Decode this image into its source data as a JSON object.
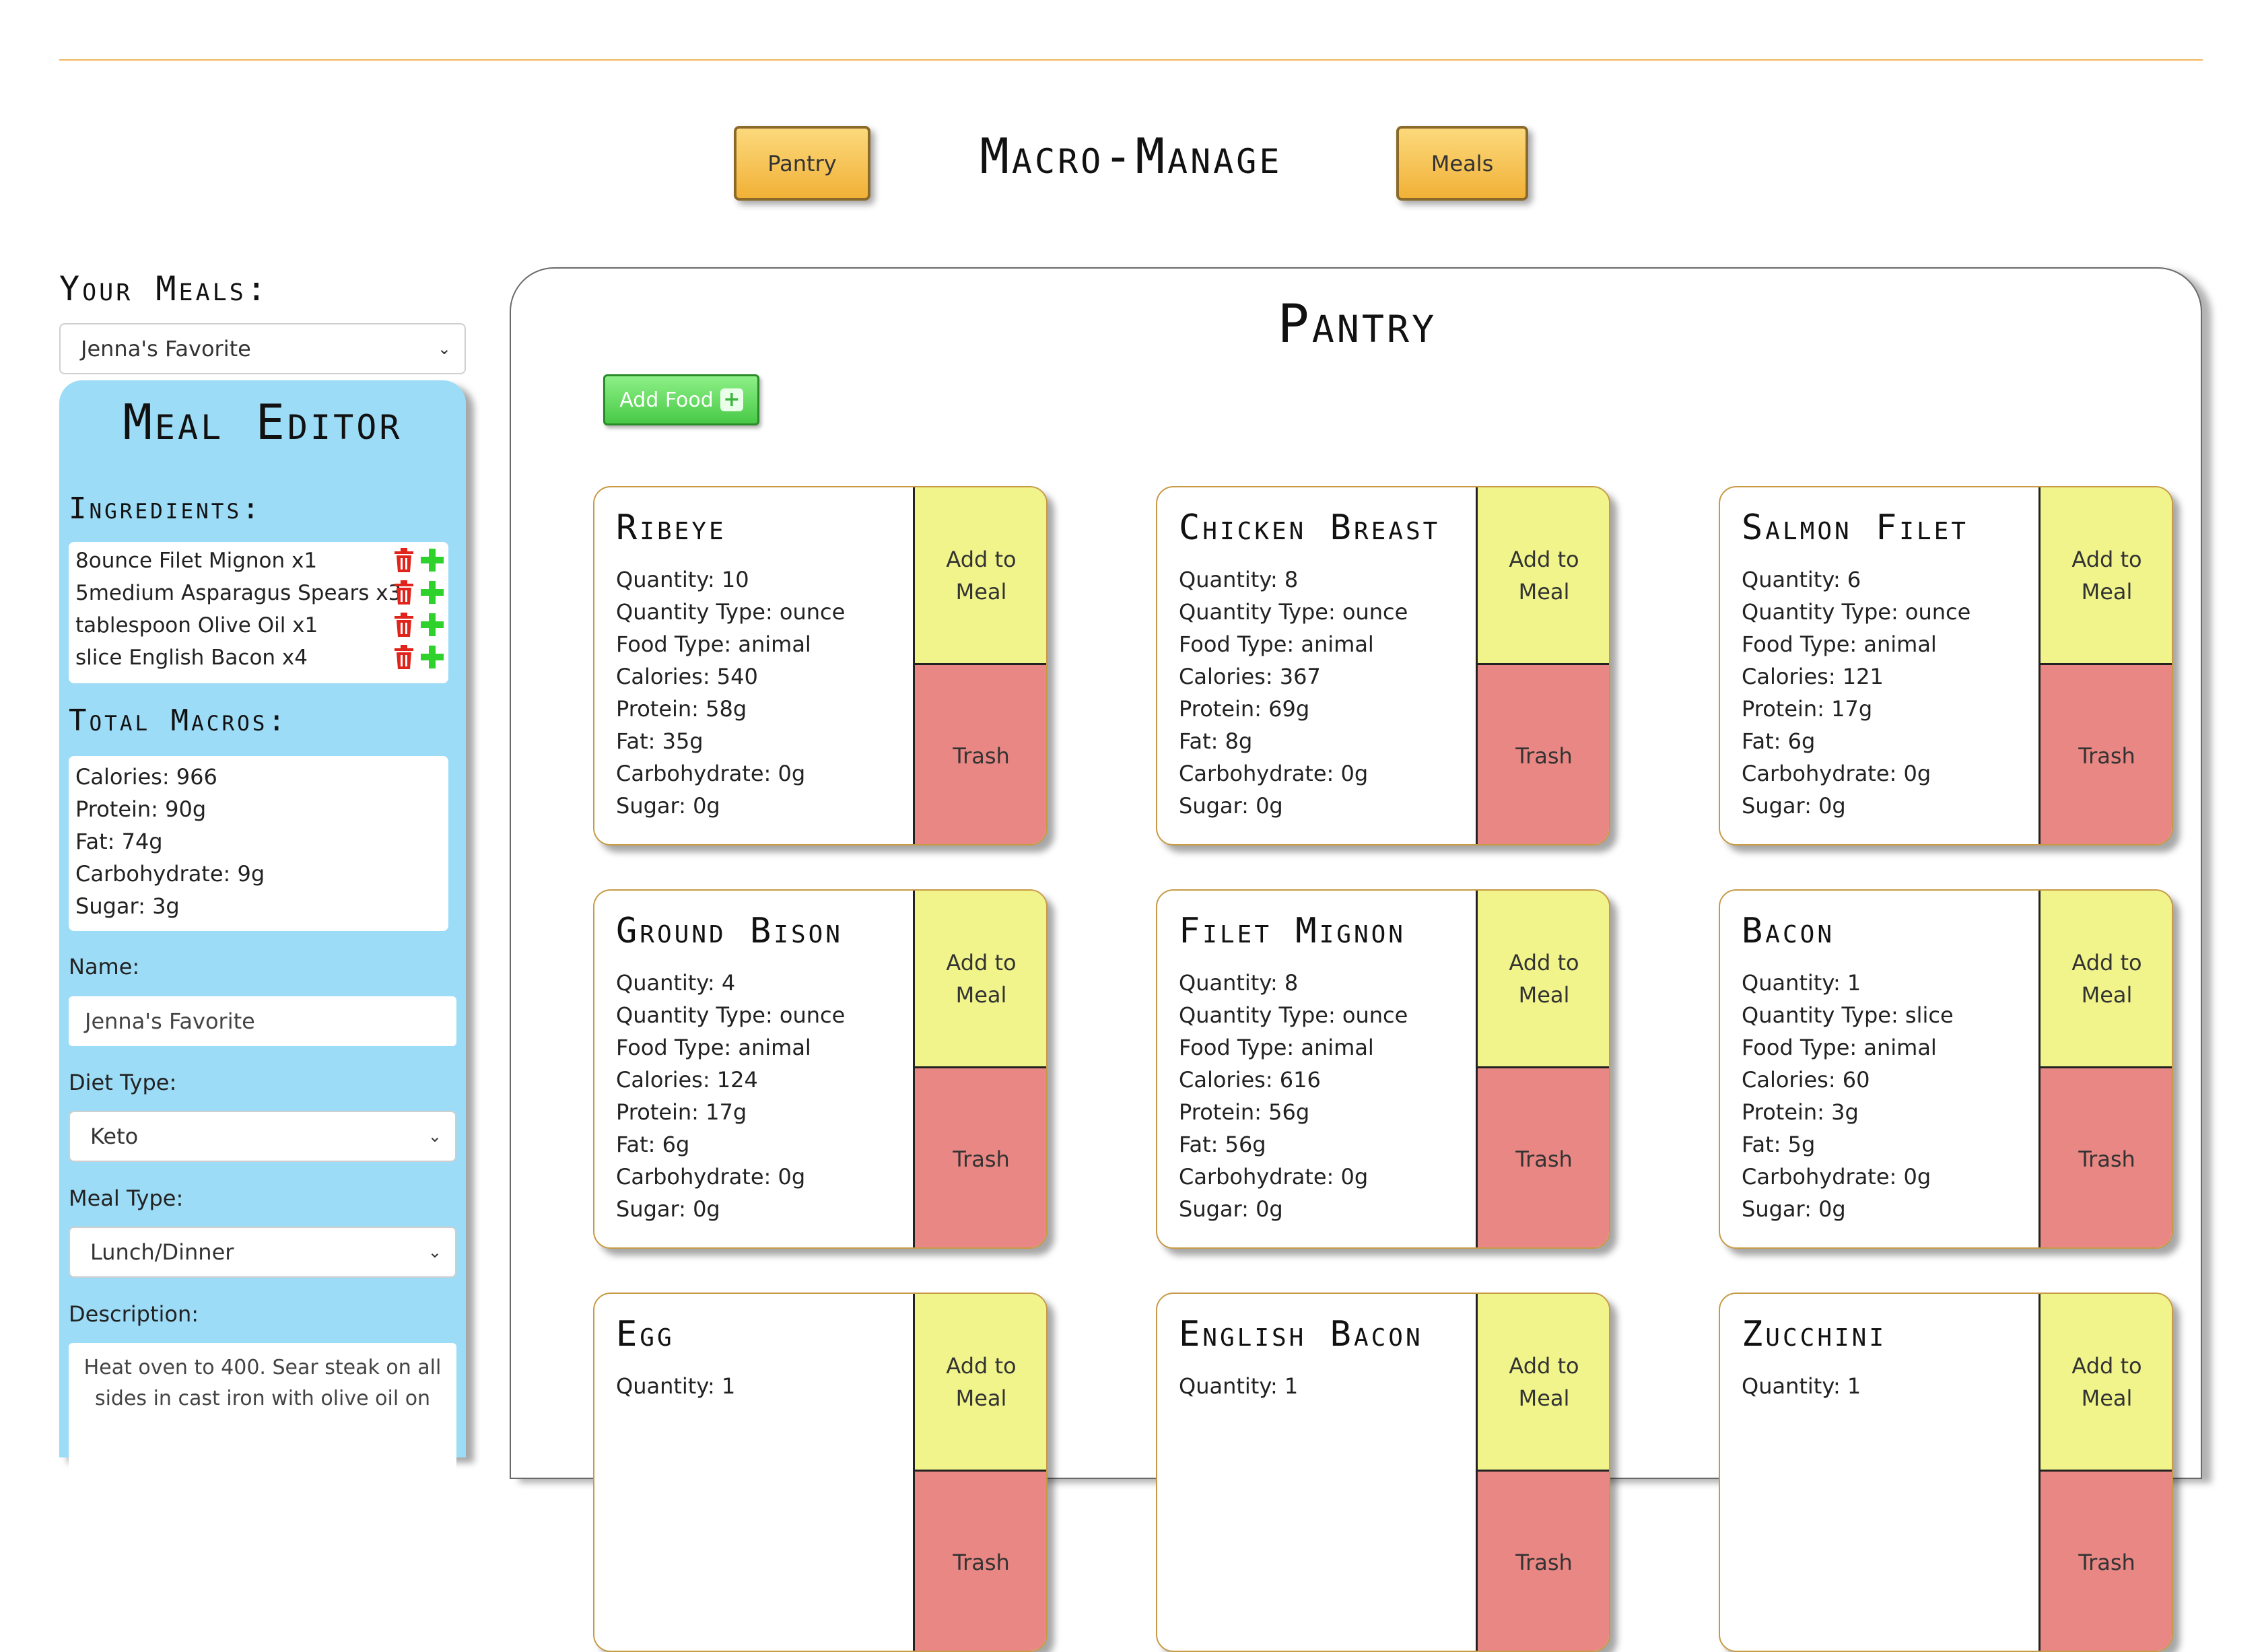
{
  "header": {
    "title": "Macro-Manage",
    "pantry_button": "Pantry",
    "meals_button": "Meals"
  },
  "sidebar": {
    "your_meals_label": "Your Meals:",
    "meal_select_value": "Jenna's Favorite",
    "editor_title": "Meal Editor",
    "ingredients_label": "Ingredients:",
    "ingredients": [
      "8ounce Filet Mignon x1",
      "5medium Asparagus Spears x3",
      "tablespoon Olive Oil x1",
      "slice English Bacon x4"
    ],
    "total_macros_label": "Total Macros:",
    "macros": [
      "Calories: 966",
      "Protein: 90g",
      "Fat: 74g",
      "Carbohydrate: 9g",
      "Sugar: 3g"
    ],
    "name_label": "Name:",
    "name_value": "Jenna's Favorite",
    "diet_label": "Diet Type:",
    "diet_value": "Keto",
    "meal_type_label": "Meal Type:",
    "meal_type_value": "Lunch/Dinner",
    "description_label": "Description:",
    "description_value": "Heat oven to 400. Sear steak on all sides in cast iron with olive oil on"
  },
  "pantry": {
    "title": "Pantry",
    "add_food_label": "Add Food",
    "add_to_meal_line1": "Add to",
    "add_to_meal_line2": "Meal",
    "trash_label": "Trash",
    "items": [
      {
        "name": "Ribeye",
        "lines": [
          "Quantity: 10",
          "Quantity Type: ounce",
          "Food Type: animal",
          "Calories: 540",
          "Protein: 58g",
          "Fat: 35g",
          "Carbohydrate: 0g",
          "Sugar: 0g"
        ]
      },
      {
        "name": "Chicken Breast",
        "lines": [
          "Quantity: 8",
          "Quantity Type: ounce",
          "Food Type: animal",
          "Calories: 367",
          "Protein: 69g",
          "Fat: 8g",
          "Carbohydrate: 0g",
          "Sugar: 0g"
        ]
      },
      {
        "name": "Salmon Filet",
        "lines": [
          "Quantity: 6",
          "Quantity Type: ounce",
          "Food Type: animal",
          "Calories: 121",
          "Protein: 17g",
          "Fat: 6g",
          "Carbohydrate: 0g",
          "Sugar: 0g"
        ]
      },
      {
        "name": "Ground Bison",
        "lines": [
          "Quantity: 4",
          "Quantity Type: ounce",
          "Food Type: animal",
          "Calories: 124",
          "Protein: 17g",
          "Fat: 6g",
          "Carbohydrate: 0g",
          "Sugar: 0g"
        ]
      },
      {
        "name": "Filet Mignon",
        "lines": [
          "Quantity: 8",
          "Quantity Type: ounce",
          "Food Type: animal",
          "Calories: 616",
          "Protein: 56g",
          "Fat: 56g",
          "Carbohydrate: 0g",
          "Sugar: 0g"
        ]
      },
      {
        "name": "Bacon",
        "lines": [
          "Quantity: 1",
          "Quantity Type: slice",
          "Food Type: animal",
          "Calories: 60",
          "Protein: 3g",
          "Fat: 5g",
          "Carbohydrate: 0g",
          "Sugar: 0g"
        ]
      },
      {
        "name": "Egg",
        "lines": [
          "Quantity: 1"
        ]
      },
      {
        "name": "English Bacon",
        "lines": [
          "Quantity: 1"
        ]
      },
      {
        "name": "Zucchini",
        "lines": [
          "Quantity: 1"
        ]
      }
    ]
  }
}
